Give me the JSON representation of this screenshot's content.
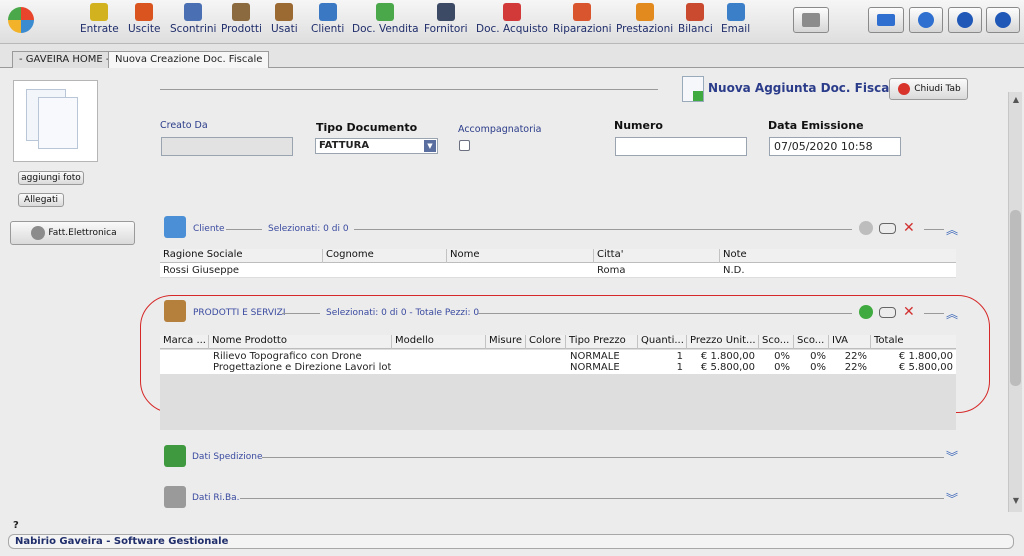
{
  "toolbar": {
    "items": [
      {
        "label": "Entrate",
        "icon": "coin-up-icon",
        "color": "#d3b21f"
      },
      {
        "label": "Uscite",
        "icon": "coin-down-icon",
        "color": "#d9541e"
      },
      {
        "label": "Scontrini",
        "icon": "receipt-icon",
        "color": "#4a6fb3"
      },
      {
        "label": "Prodotti",
        "icon": "products-icon",
        "color": "#8a6a3e"
      },
      {
        "label": "Usati",
        "icon": "box-icon",
        "color": "#9b6a33"
      },
      {
        "label": "Clienti",
        "icon": "client-icon",
        "color": "#3b78c4"
      },
      {
        "label": "Doc. Vendita",
        "icon": "sale-doc-icon",
        "color": "#4aa84a"
      },
      {
        "label": "Fornitori",
        "icon": "supplier-icon",
        "color": "#3c4a66"
      },
      {
        "label": "Doc. Acquisto",
        "icon": "purchase-doc-icon",
        "color": "#d23a3a"
      },
      {
        "label": "Riparazioni",
        "icon": "repair-icon",
        "color": "#d8552e"
      },
      {
        "label": "Prestazioni",
        "icon": "service-icon",
        "color": "#e38a1f"
      },
      {
        "label": "Bilanci",
        "icon": "balance-icon",
        "color": "#c94a2e"
      },
      {
        "label": "Email",
        "icon": "email-icon",
        "color": "#3b7fc9"
      }
    ],
    "right_icons": [
      "printer-icon",
      "keyboard-icon",
      "settings-icon",
      "minimize-icon",
      "power-icon"
    ]
  },
  "tabs": [
    {
      "label": "- GAVEIRA HOME -"
    },
    {
      "label": "Nuova Creazione Doc. Fiscale"
    }
  ],
  "header": {
    "title": "Nuova Aggiunta Doc. Fiscale",
    "close_tab": "Chiudi Tab"
  },
  "left": {
    "add_photo": "aggiungi foto",
    "attachments": "Allegati",
    "e_invoice": "Fatt.Elettronica"
  },
  "form": {
    "created_by_label": "Creato Da",
    "created_by_value": "",
    "doc_type_label": "Tipo Documento",
    "doc_type_value": "FATTURA",
    "accompanying_label": "Accompagnatoria",
    "number_label": "Numero",
    "number_value": "",
    "date_label": "Data Emissione",
    "date_value": "07/05/2020 10:58"
  },
  "client_section": {
    "title": "Cliente",
    "selected": "Selezionati:    0 di 0",
    "columns": [
      "Ragione Sociale",
      "Cognome",
      "Nome",
      "Citta'",
      "Note"
    ],
    "rows": [
      [
        "Rossi Giuseppe",
        "",
        "",
        "Roma",
        "N.D."
      ]
    ]
  },
  "products_section": {
    "title": "PRODOTTI E SERVIZI",
    "selected": "Selezionati:    0 di 0 - Totale Pezzi: 0",
    "columns": [
      "Marca ...",
      "Nome Prodotto",
      "Modello",
      "Misure",
      "Colore",
      "Tipo Prezzo",
      "Quanti...",
      "Prezzo Unit...",
      "Sco...",
      "Sco...",
      "IVA",
      "Totale"
    ],
    "rows": [
      [
        "",
        "Rilievo Topografico con Drone",
        "",
        "",
        "",
        "NORMALE",
        "1",
        "€ 1.800,00",
        "0%",
        "0%",
        "22%",
        "€ 1.800,00"
      ],
      [
        "",
        "Progettazione e Direzione Lavori lot...",
        "",
        "",
        "",
        "NORMALE",
        "1",
        "€ 5.800,00",
        "0%",
        "0%",
        "22%",
        "€ 5.800,00"
      ]
    ]
  },
  "shipping_section": {
    "title": "Dati Spedizione"
  },
  "riba_section": {
    "title": "Dati Ri.Ba."
  },
  "misc": {
    "question_mark": "?"
  },
  "footer": {
    "text": "Nabirio Gaveira - Software Gestionale"
  },
  "colors": {
    "highlight": "#d62828",
    "accent": "#2b3c8a"
  }
}
